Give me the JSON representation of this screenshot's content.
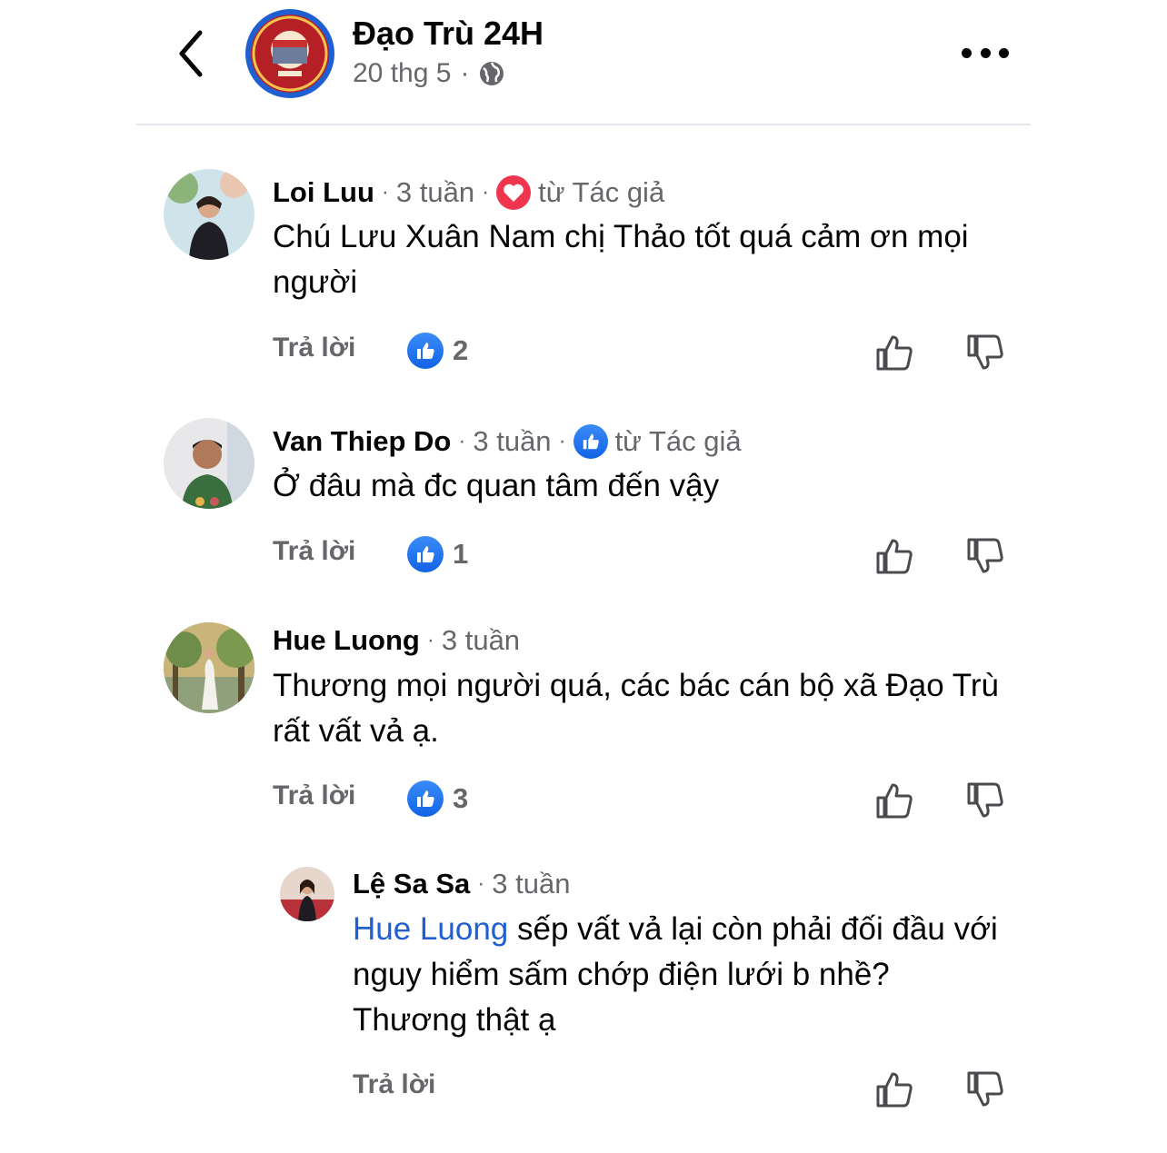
{
  "header": {
    "page_name": "Đạo Trù 24H",
    "date": "20 thg 5",
    "dot": "·",
    "privacy_icon": "globe-icon",
    "back_icon": "chevron-left-icon",
    "more_icon": "more-horizontal-icon"
  },
  "ui": {
    "reply_label": "Trả lời",
    "author_tag": "từ Tác giả",
    "dot": "·"
  },
  "colors": {
    "accent_blue": "#1f5fd1",
    "like_blue": "#1877f2",
    "heart_red": "#f0364f",
    "muted_text": "#65676b"
  },
  "comments": [
    {
      "author": "Loi Luu",
      "time": "3 tuần",
      "reaction_icon": "heart-icon",
      "tag": "từ Tác giả",
      "text": "Chú Lưu Xuân Nam chị Thảo tốt quá cảm ơn mọi người",
      "likes": "2"
    },
    {
      "author": "Van Thiep Do",
      "time": "3 tuần",
      "reaction_icon": "like-icon",
      "tag": "từ Tác giả",
      "text": "Ở đâu mà đc quan tâm đến vậy",
      "likes": "1"
    },
    {
      "author": "Hue Luong",
      "time": "3 tuần",
      "text": "Thương mọi người quá, các bác cán bộ xã Đạo Trù rất vất vả ạ.",
      "likes": "3"
    }
  ],
  "reply": {
    "author": "Lệ Sa Sa",
    "time": "3 tuần",
    "mention": "Hue Luong",
    "text": " sếp vất vả lại còn phải đối đầu với nguy hiểm sấm chớp điện lưới b nhề? Thương thật ạ"
  }
}
